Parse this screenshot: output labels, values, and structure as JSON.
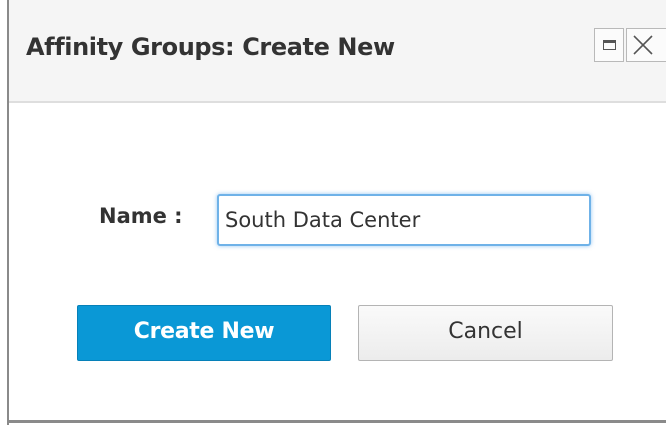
{
  "dialog": {
    "title": "Affinity Groups: Create New",
    "controls": {
      "maximize_icon": "maximize-icon",
      "close_icon": "close-icon"
    }
  },
  "form": {
    "name_label": "Name :",
    "name_value": "South Data Center"
  },
  "buttons": {
    "create_label": "Create New",
    "cancel_label": "Cancel"
  },
  "colors": {
    "primary_button": "#0a98d6",
    "input_focus_border": "#6fb2e8",
    "header_background": "#f5f5f5"
  }
}
